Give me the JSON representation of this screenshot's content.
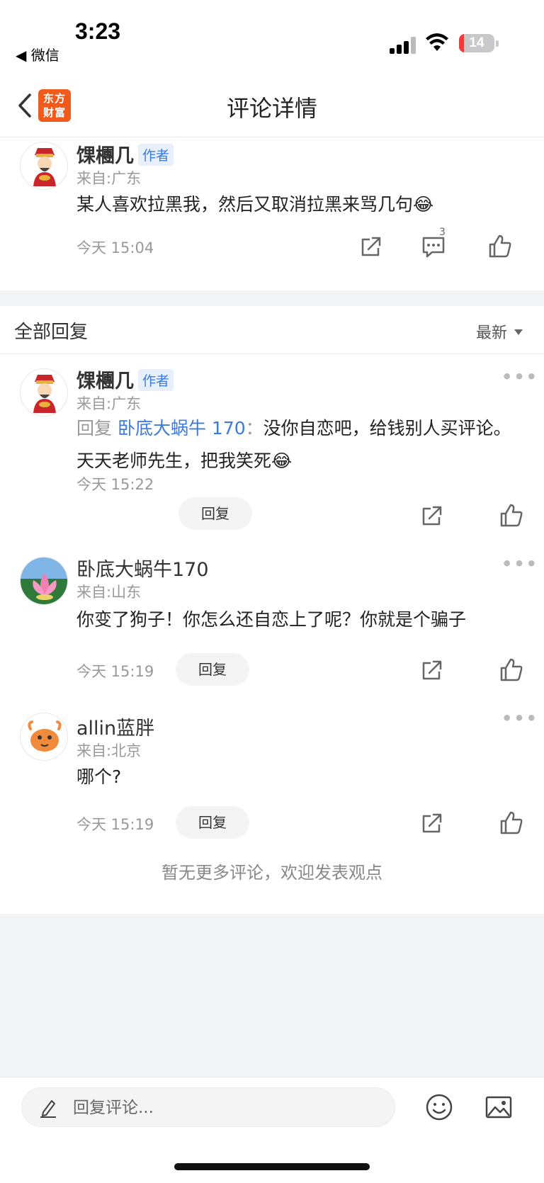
{
  "status_bar": {
    "time": "3:23",
    "back_app": "◀ 微信",
    "battery": "14",
    "battery_level": 0.14
  },
  "nav": {
    "title": "评论详情",
    "logo_text": "东方财富"
  },
  "main_comment": {
    "username": "馃檲几",
    "author_tag": "作者",
    "from": "来自:广东",
    "content": "某人喜欢拉黑我，然后又取消拉黑来骂几句😂",
    "time": "今天 15:04",
    "reply_count": "3"
  },
  "replies_section": {
    "title": "全部回复",
    "sort": "最新",
    "items": [
      {
        "username": "馃檲几",
        "author_tag": "作者",
        "from": "来自:广东",
        "reply_prefix": "回复",
        "reply_target": "卧底大蜗牛 170",
        "reply_colon": "：",
        "content": "没你自恋吧，给钱别人买评论。天天老师先生，把我笑死😂",
        "time": "今天 15:22",
        "reply_label": "回复"
      },
      {
        "username": "卧底大蜗牛170",
        "from": "来自:山东",
        "content": "你变了狗子！你怎么还自恋上了呢？你就是个骗子",
        "time": "今天 15:19",
        "reply_label": "回复"
      },
      {
        "username": "allin蓝胖",
        "from": "来自:北京",
        "content": "哪个?",
        "time": "今天 15:19",
        "reply_label": "回复"
      }
    ],
    "footer": "暂无更多评论，欢迎发表观点"
  },
  "bottom_bar": {
    "placeholder": "回复评论..."
  },
  "more_glyph": "•••",
  "colors": {
    "accent": "#3b7bdc",
    "logo": "#f25a1c",
    "battery_low": "#f23b3b"
  }
}
